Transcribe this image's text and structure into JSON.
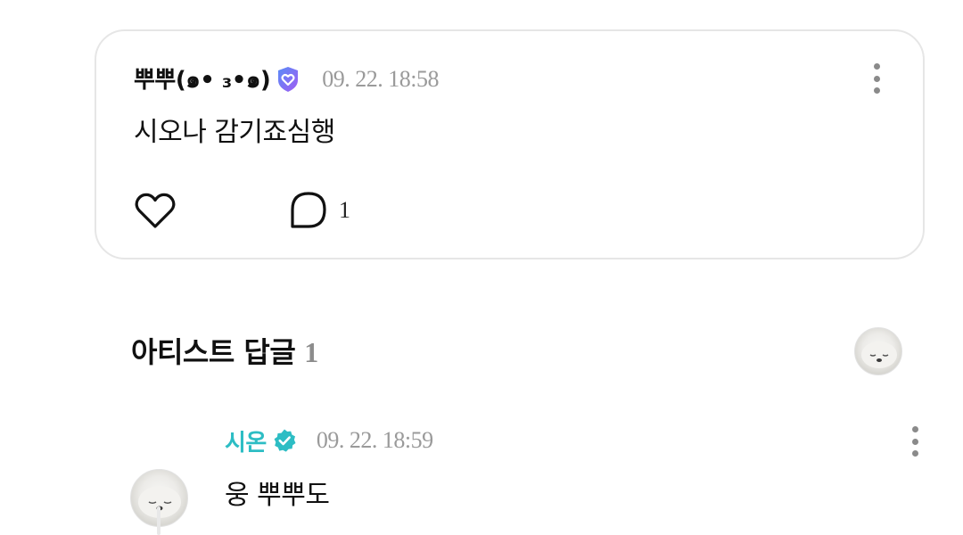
{
  "post": {
    "author": "뿌뿌(๑• ₃•๑)",
    "timestamp": "09. 22. 18:58",
    "body": "시오나 감기죠심행",
    "comment_count": "1",
    "badge_color": "#7b6cf6"
  },
  "artist_replies": {
    "title": "아티스트 답글",
    "count": "1"
  },
  "reply": {
    "author": "시온",
    "timestamp": "09. 22. 18:59",
    "body": "웅 뿌뿌도",
    "name_color": "#2dbdc4"
  },
  "icons": {
    "more": "more-vertical-icon",
    "like": "heart-icon",
    "comment": "comment-bubble-icon",
    "verified": "verified-check-icon",
    "fan_badge": "heart-badge-icon"
  }
}
